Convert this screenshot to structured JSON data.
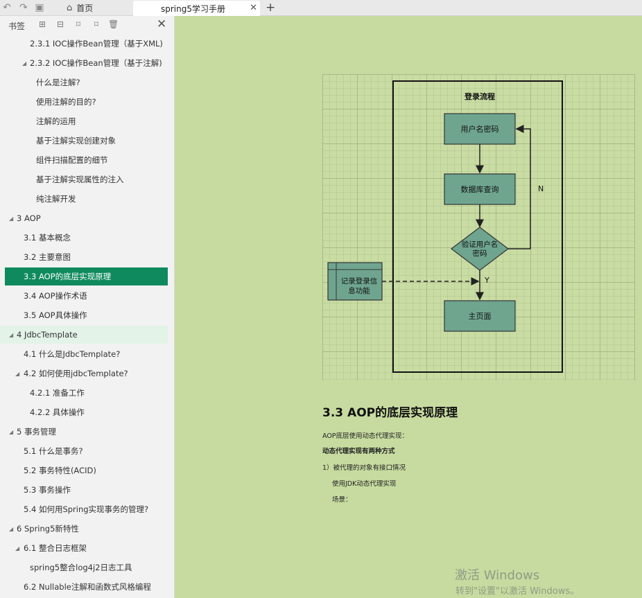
{
  "tabs": {
    "home_label": "首页",
    "doc_label": "spring5学习手册"
  },
  "sidebar": {
    "title": "书签",
    "items": [
      {
        "label": "2.3.1 IOC操作Bean管理（基于XML)"
      },
      {
        "label": "2.3.2 IOC操作Bean管理（基于注解)"
      },
      {
        "label": "什么是注解?"
      },
      {
        "label": "使用注解的目的?"
      },
      {
        "label": "注解的运用"
      },
      {
        "label": "基于注解实现创建对象"
      },
      {
        "label": "组件扫描配置的细节"
      },
      {
        "label": "基于注解实现属性的注入"
      },
      {
        "label": "纯注解开发"
      },
      {
        "label": "3 AOP"
      },
      {
        "label": "3.1 基本概念"
      },
      {
        "label": "3.2 主要意图"
      },
      {
        "label": "3.3 AOP的底层实现原理"
      },
      {
        "label": "3.4 AOP操作术语"
      },
      {
        "label": "3.5 AOP具体操作"
      },
      {
        "label": "4 JdbcTemplate"
      },
      {
        "label": "4.1 什么是JdbcTemplate?"
      },
      {
        "label": "4.2 如何使用jdbcTemplate?"
      },
      {
        "label": "4.2.1 准备工作"
      },
      {
        "label": "4.2.2 具体操作"
      },
      {
        "label": "5 事务管理"
      },
      {
        "label": "5.1 什么是事务?"
      },
      {
        "label": "5.2 事务特性(ACID)"
      },
      {
        "label": "5.3 事务操作"
      },
      {
        "label": "5.4 如何用Spring实现事务的管理?"
      },
      {
        "label": "6 Spring5新特性"
      },
      {
        "label": "6.1 整合日志框架"
      },
      {
        "label": "spring5整合log4j2日志工具"
      },
      {
        "label": "6.2 Nullable注解和函数式风格编程"
      }
    ]
  },
  "diagram": {
    "title": "登录流程",
    "node_input": "用户名密码",
    "node_db": "数据库查询",
    "node_verify_l1": "验证用户名",
    "node_verify_l2": "密码",
    "node_home": "主页面",
    "node_log_l1": "记录登录信",
    "node_log_l2": "息功能",
    "label_no": "N",
    "label_yes": "Y"
  },
  "content": {
    "heading": "3.3 AOP的底层实现原理",
    "p1": "AOP底层使用动态代理实现：",
    "p2": "动态代理实现有两种方式",
    "p3": "1）被代理的对象有接口情况",
    "p4": "使用JDK动态代理实现",
    "p5": "场景："
  },
  "watermark": {
    "line1": "激活 Windows",
    "line2": "转到\"设置\"以激活 Windows。"
  },
  "colors": {
    "selected": "#0f8a5f",
    "node_fill": "#6fa58f",
    "page_bg": "#c7dba0"
  }
}
